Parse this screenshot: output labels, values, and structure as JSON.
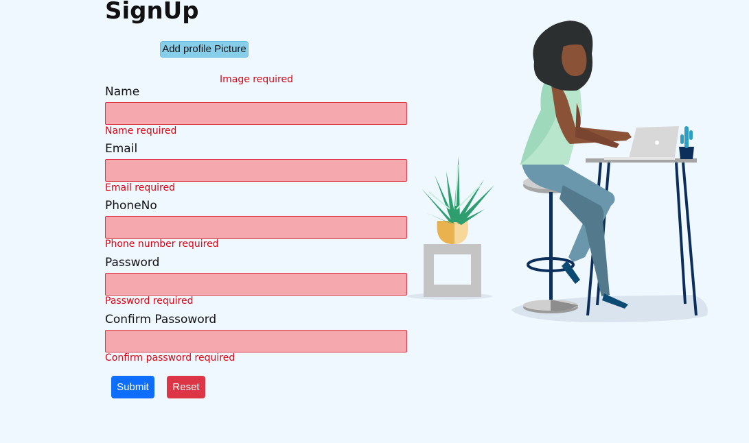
{
  "form": {
    "title": "SignUp",
    "upload_label": "Add profile Picture",
    "image_error": "Image required",
    "fields": [
      {
        "label": "Name",
        "value": "",
        "error": "Name required"
      },
      {
        "label": "Email",
        "value": "",
        "error": "Email required"
      },
      {
        "label": "PhoneNo",
        "value": "",
        "error": "Phone number required"
      },
      {
        "label": "Password",
        "value": "",
        "error": "Password required"
      },
      {
        "label": "Confirm Passoword",
        "value": "",
        "error": "Confirm password required"
      }
    ],
    "submit_label": "Submit",
    "reset_label": "Reset"
  },
  "colors": {
    "background": "#f0f8ff",
    "field_invalid_bg": "#f5a9ae",
    "error_text": "#e0000f",
    "submit": "#0d6efd",
    "reset": "#dc3545",
    "upload": "#87ceeb"
  },
  "illustration": "woman-working-on-laptop-illustration"
}
